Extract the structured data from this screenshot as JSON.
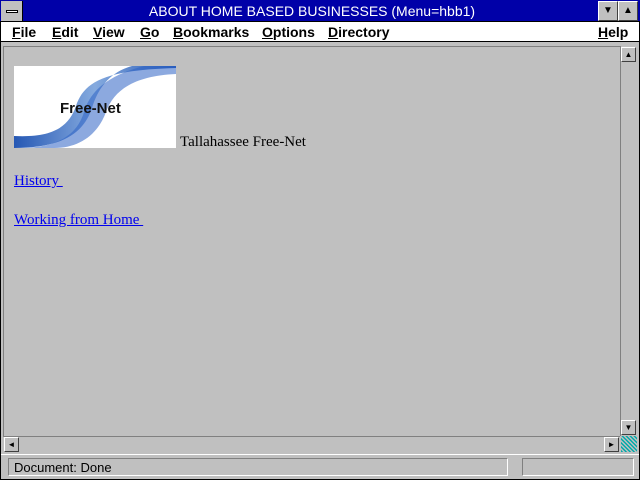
{
  "window": {
    "title": "ABOUT HOME BASED BUSINESSES (Menu=hbb1)"
  },
  "menubar": {
    "items": [
      {
        "label": "File",
        "mnemonic": "F",
        "rest": "ile"
      },
      {
        "label": "Edit",
        "mnemonic": "E",
        "rest": "dit"
      },
      {
        "label": "View",
        "mnemonic": "V",
        "rest": "iew"
      },
      {
        "label": "Go",
        "mnemonic": "G",
        "rest": "o"
      },
      {
        "label": "Bookmarks",
        "mnemonic": "B",
        "rest": "ookmarks"
      },
      {
        "label": "Options",
        "mnemonic": "O",
        "rest": "ptions"
      },
      {
        "label": "Directory",
        "mnemonic": "D",
        "rest": "irectory"
      },
      {
        "label": "Help",
        "mnemonic": "H",
        "rest": "elp"
      }
    ]
  },
  "content": {
    "logo_text": "Free-Net",
    "site_name": "Tallahassee Free-Net",
    "links": [
      {
        "label": "History "
      },
      {
        "label": "Working from Home "
      }
    ]
  },
  "status": {
    "text": "Document: Done"
  },
  "colors": {
    "titlebar": "#0000a8",
    "link": "#0000ee",
    "background": "#c0c0c0"
  }
}
